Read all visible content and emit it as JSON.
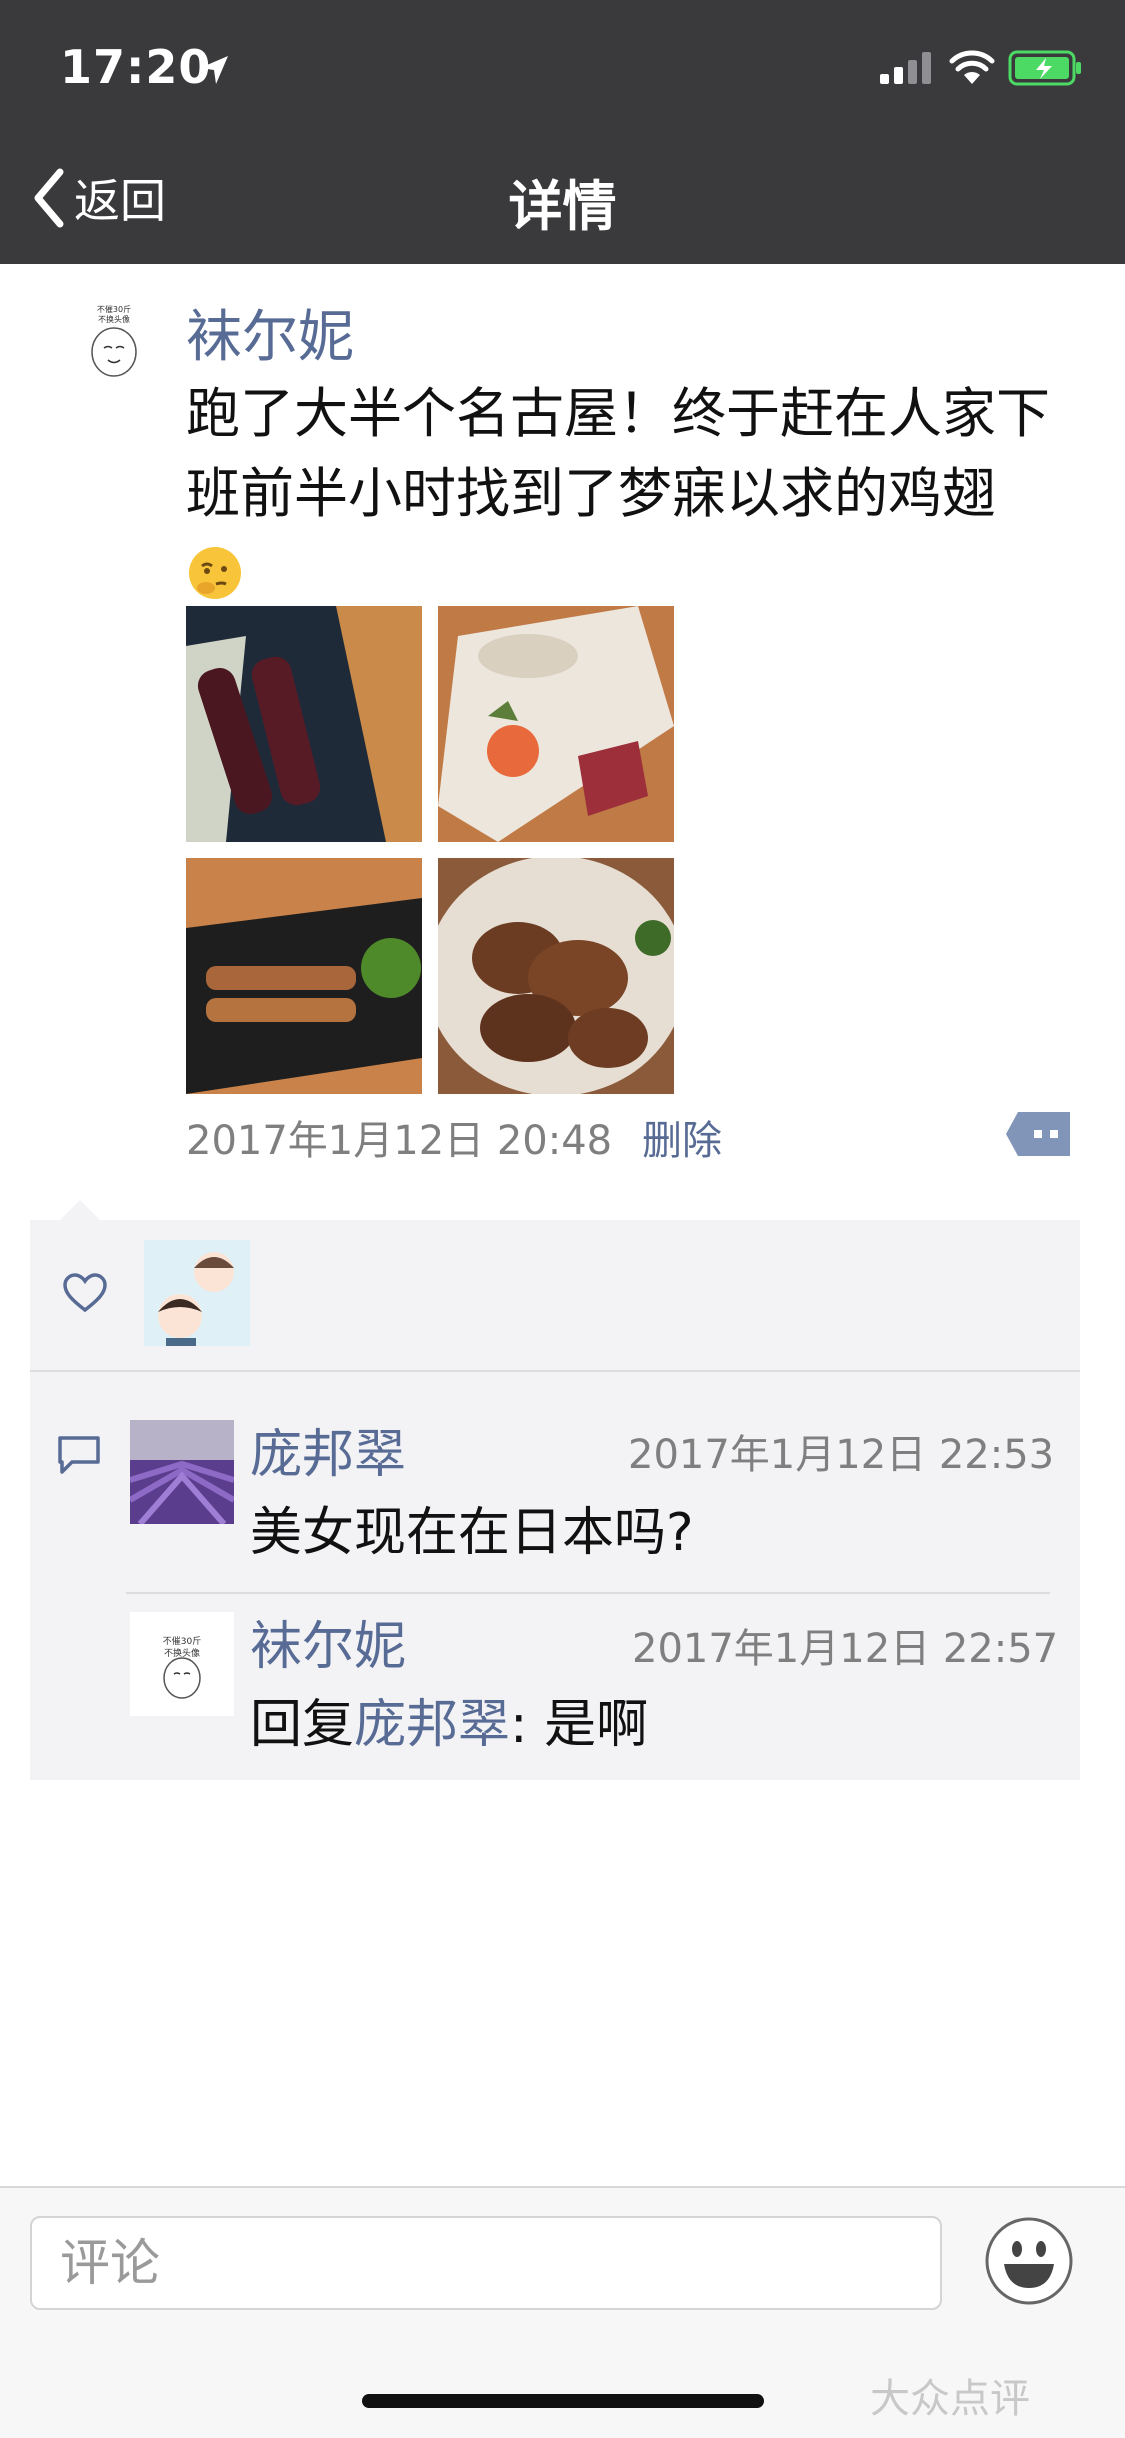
{
  "status_bar": {
    "time": "17:20"
  },
  "nav": {
    "back_label": "返回",
    "title": "详情"
  },
  "post": {
    "author": "袜尔妮",
    "text": "跑了大半个名古屋！终于赶在人家下班前半小时找到了梦寐以求的鸡翅",
    "timestamp": "2017年1月12日 20:48",
    "delete_label": "删除",
    "avatar_caption": [
      "不催30斤",
      "不换头像"
    ]
  },
  "comments": [
    {
      "author": "庞邦翠",
      "time": "2017年1月12日 22:53",
      "text": "美女现在在日本吗?"
    },
    {
      "author": "袜尔妮",
      "time": "2017年1月12日 22:57",
      "reply_prefix": "回复",
      "reply_to": "庞邦翠",
      "reply_text": ": 是啊"
    }
  ],
  "input": {
    "placeholder": "评论"
  },
  "watermark": "大众点评",
  "colors": {
    "nav_bg": "#3a3a3c",
    "link": "#576b95",
    "panel_bg": "#f3f3f5",
    "battery": "#4cd964"
  },
  "icons": [
    "location-arrow-icon",
    "signal-icon",
    "wifi-icon",
    "battery-icon",
    "back-chevron-icon",
    "thinking-emoji-icon",
    "comment-action-icon",
    "heart-icon",
    "comment-icon",
    "smiley-icon"
  ]
}
